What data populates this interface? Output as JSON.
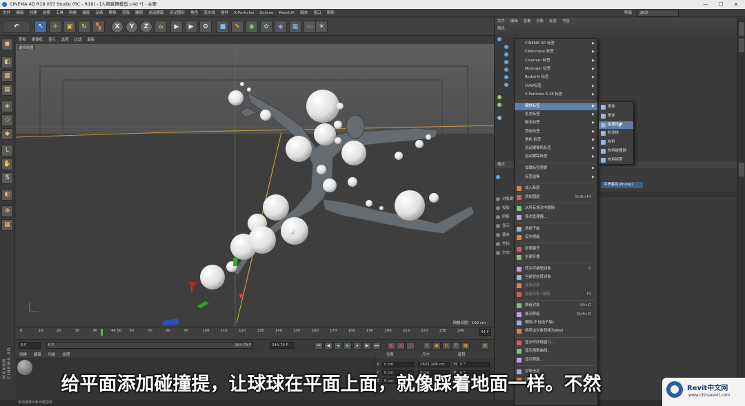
{
  "window": {
    "title": "CINEMA 4D R18.057 Studio (RC - R18) - [人物跳舞模型.c4d *] - 主要",
    "minimize": "—",
    "maximize": "☐",
    "close": "✕"
  },
  "menubar": {
    "items": [
      "文件",
      "编辑",
      "创建",
      "选择",
      "工具",
      "网格",
      "捕捉",
      "动画",
      "模拟",
      "渲染",
      "雕刻",
      "运动跟踪",
      "运动图形",
      "角色",
      "流水线",
      "插件",
      "X-Particles",
      "Octane",
      "Redshift",
      "脚本",
      "窗口",
      "帮助"
    ],
    "layout_label": "界面",
    "layout_value": "启动"
  },
  "toolbar": {
    "icons": [
      "undo-icon",
      "select-icon",
      "move-icon",
      "scale-icon",
      "rotate-icon",
      "last-tool-icon",
      "x-axis-icon",
      "y-axis-icon",
      "z-axis-icon",
      "coord-system-icon",
      "render-view-icon",
      "render-picture-icon",
      "render-settings-icon",
      "cube-icon",
      "pen-icon",
      "subdivision-icon",
      "array-icon",
      "deformer-icon",
      "floor-icon",
      "camera-icon",
      "light-icon"
    ],
    "labels": {
      "x": "X",
      "y": "Y",
      "z": "Z"
    }
  },
  "viewport": {
    "menu": [
      "查看",
      "摄像机",
      "显示",
      "选项",
      "过滤",
      "面板"
    ],
    "label": "透视视图",
    "grid_spacing": "网格间距：100 cm"
  },
  "timeline": {
    "ticks": [
      "0",
      "10",
      "20",
      "30",
      "40",
      "44 50",
      "60",
      "70",
      "80",
      "90",
      "100",
      "110",
      "120",
      "130",
      "140",
      "150",
      "160",
      "170",
      "180",
      "190",
      "200",
      "210",
      "220",
      "230",
      "240"
    ],
    "current_frame_field": "44 F",
    "current_marker": "44"
  },
  "transport": {
    "start": "0 F",
    "start2": "0 F",
    "end": "244.79 F",
    "end2": "244.79 F"
  },
  "materials": {
    "menu": [
      "创建",
      "编辑",
      "功能",
      "纹理"
    ]
  },
  "coordinates": {
    "headers": [
      "位置",
      "尺寸",
      "旋转"
    ],
    "rows": [
      {
        "axis": "X",
        "pos": "0 cm",
        "size": "2825.108 cm",
        "rot_label": "H",
        "rot": "0 °"
      },
      {
        "axis": "Y",
        "pos": "0 cm",
        "size": "0 cm",
        "rot_label": "P",
        "rot": "0 °"
      },
      {
        "axis": "Z",
        "pos": "0 cm",
        "size": "",
        "rot_label": "B",
        "rot": "0 °"
      }
    ]
  },
  "status": "添加选择对象为碰撞体",
  "right_panel": {
    "tabs": [
      "文件",
      "编辑",
      "查看",
      "对象",
      "标签",
      "书签"
    ],
    "sub": "随机",
    "attr_mode": "模式",
    "attr_rows": [
      "对象属性",
      "投影",
      "阴影",
      "显示",
      "基本",
      "坐标",
      "方向"
    ],
    "phong": "平滑着色(Phong)"
  },
  "context_menu": {
    "items": [
      {
        "label": "CINEMA 4D 标签",
        "arrow": true
      },
      {
        "label": "C4doctane 标签",
        "arrow": true
      },
      {
        "label": "Cineman 标签",
        "arrow": true
      },
      {
        "label": "MoGraph 标签",
        "arrow": true
      },
      {
        "label": "Redshift 标签",
        "arrow": true
      },
      {
        "label": "UVW标签",
        "arrow": true
      },
      {
        "label": "X-Particles 6.16 标签",
        "arrow": true
      },
      {
        "label": "模拟标签",
        "arrow": true,
        "highlight": true
      },
      {
        "label": "毛发标签",
        "arrow": true
      },
      {
        "label": "脚本标签",
        "arrow": true
      },
      {
        "label": "草绘标签",
        "arrow": true
      },
      {
        "label": "角色 标签",
        "arrow": true
      },
      {
        "label": "运动摄像机标签",
        "arrow": true
      },
      {
        "label": "运动跟踪标签",
        "arrow": true
      },
      {
        "label": "加载标签预置",
        "arrow": true
      },
      {
        "label": "标签选集",
        "arrow": true
      },
      {
        "label": "加入新层",
        "arrow": false
      },
      {
        "label": "添加图层",
        "arrow": false,
        "shortcut": "Shift+F4"
      },
      {
        "label": "从所有场次中删除",
        "arrow": false
      },
      {
        "label": "场次管理器...",
        "arrow": false
      },
      {
        "label": "选择子级",
        "arrow": false
      },
      {
        "label": "设为根级",
        "arrow": false
      },
      {
        "label": "全部展开",
        "arrow": false
      },
      {
        "label": "全部折叠",
        "arrow": false
      },
      {
        "label": "转为可编辑对象",
        "arrow": false,
        "shortcut": "C"
      },
      {
        "label": "当前状态转对象",
        "arrow": false
      },
      {
        "label": "连接对象",
        "arrow": false,
        "dim": true
      },
      {
        "label": "连接对象+删除",
        "arrow": false,
        "dim": true,
        "shortcut": "F1"
      },
      {
        "label": "群组对象",
        "arrow": false,
        "shortcut": "Alt+G"
      },
      {
        "label": "展开群组",
        "arrow": false,
        "shortcut": "Shift+G"
      },
      {
        "label": "删除(不包括子级)",
        "arrow": false
      },
      {
        "label": "将所选对象转换为XRef",
        "arrow": false
      },
      {
        "label": "显示时间线窗口...",
        "arrow": false
      },
      {
        "label": "显示函数曲线...",
        "arrow": false
      },
      {
        "label": "显示帮助...",
        "arrow": false
      },
      {
        "label": "对象信息",
        "arrow": false
      },
      {
        "label": "显示帮助",
        "arrow": false,
        "shortcut": "Ctrl+F1"
      }
    ]
  },
  "sub_menu": {
    "items": [
      {
        "label": "刚体",
        "highlight": false
      },
      {
        "label": "柔体",
        "highlight": false
      },
      {
        "label": "碰撞体",
        "highlight": true
      },
      {
        "label": "检测体",
        "highlight": false
      },
      {
        "label": "布料",
        "highlight": false
      },
      {
        "label": "布料碰撞器",
        "highlight": false
      },
      {
        "label": "布料绑带",
        "highlight": false
      }
    ]
  },
  "subtitle": "给平面添加碰撞提，让球球在平面上面，就像踩着地面一样。不然",
  "watermark": {
    "title": "Revit中文网",
    "url": "www.chinarevit.com"
  },
  "maxon": "MAXON CINEMA 4D",
  "colors": {
    "highlight": "#5e7fa6",
    "viewport": "#575757",
    "panel": "#3b3b3b"
  }
}
